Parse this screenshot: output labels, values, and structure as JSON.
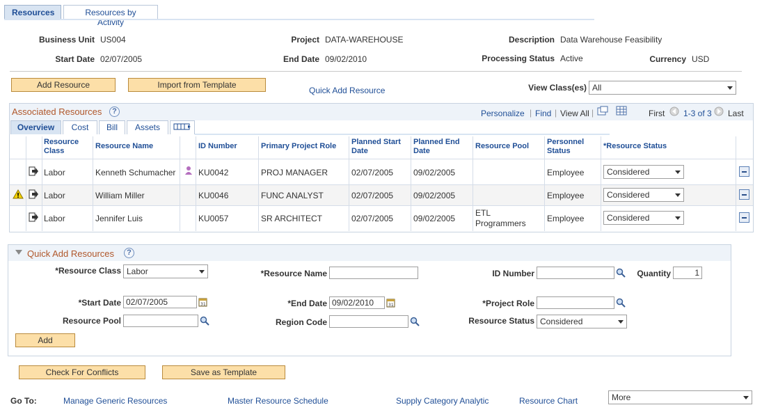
{
  "tabs": {
    "resources": "Resources",
    "by_activity": "Resources by Activity"
  },
  "header": {
    "business_unit_label": "Business Unit",
    "business_unit": "US004",
    "project_label": "Project",
    "project": "DATA-WAREHOUSE",
    "description_label": "Description",
    "description": "Data Warehouse Feasibility",
    "start_date_label": "Start Date",
    "start_date": "02/07/2005",
    "end_date_label": "End Date",
    "end_date": "09/02/2010",
    "processing_status_label": "Processing Status",
    "processing_status": "Active",
    "currency_label": "Currency",
    "currency": "USD"
  },
  "toolbar": {
    "add_resource": "Add Resource",
    "import_template": "Import from Template",
    "quick_add_link": "Quick Add Resource",
    "view_classes_label": "View Class(es)",
    "view_classes_value": "All"
  },
  "grid": {
    "title": "Associated Resources",
    "personalize": "Personalize",
    "find": "Find",
    "view_all": "View All",
    "first": "First",
    "range": "1-3 of 3",
    "last": "Last",
    "subtabs": [
      "Overview",
      "Cost",
      "Bill",
      "Assets"
    ],
    "columns": {
      "resource_class": "Resource Class",
      "resource_name": "Resource Name",
      "id_number": "ID Number",
      "role": "Primary Project Role",
      "planned_start": "Planned Start Date",
      "planned_end": "Planned End Date",
      "pool": "Resource Pool",
      "personnel_status": "Personnel Status",
      "resource_status": "*Resource Status"
    },
    "rows": [
      {
        "class": "Labor",
        "name": "Kenneth Schumacher",
        "id": "KU0042",
        "role": "PROJ MANAGER",
        "start": "02/07/2005",
        "end": "09/02/2005",
        "pool": "",
        "personnel": "Employee",
        "status": "Considered",
        "warning": false,
        "person_icon": true
      },
      {
        "class": "Labor",
        "name": "William Miller",
        "id": "KU0046",
        "role": "FUNC ANALYST",
        "start": "02/07/2005",
        "end": "09/02/2005",
        "pool": "",
        "personnel": "Employee",
        "status": "Considered",
        "warning": true,
        "person_icon": false
      },
      {
        "class": "Labor",
        "name": "Jennifer Luis",
        "id": "KU0057",
        "role": "SR ARCHITECT",
        "start": "02/07/2005",
        "end": "09/02/2005",
        "pool": "ETL Programmers",
        "pool_line1": "ETL",
        "pool_line2": "Programmers",
        "personnel": "Employee",
        "status": "Considered",
        "warning": false,
        "person_icon": false
      }
    ]
  },
  "quick_add": {
    "title": "Quick Add Resources",
    "resource_class_label": "*Resource Class",
    "resource_class": "Labor",
    "resource_name_label": "*Resource Name",
    "resource_name": "",
    "id_number_label": "ID Number",
    "id_number": "",
    "quantity_label": "Quantity",
    "quantity": "1",
    "start_date_label": "*Start Date",
    "start_date": "02/07/2005",
    "end_date_label": "*End Date",
    "end_date": "09/02/2010",
    "project_role_label": "*Project Role",
    "project_role": "",
    "resource_pool_label": "Resource Pool",
    "resource_pool": "",
    "region_code_label": "Region Code",
    "region_code": "",
    "resource_status_label": "Resource Status",
    "resource_status": "Considered",
    "add_button": "Add"
  },
  "actions": {
    "check_conflicts": "Check For Conflicts",
    "save_template": "Save as Template"
  },
  "goto": {
    "label": "Go To:",
    "links": [
      "Manage Generic Resources",
      "Master Resource Schedule",
      "Supply Category Analytic",
      "Resource Chart"
    ],
    "more": "More"
  },
  "colors": {
    "link": "#1f4e96",
    "button_bg": "#fcdfa8",
    "section_title": "#b0572b"
  }
}
